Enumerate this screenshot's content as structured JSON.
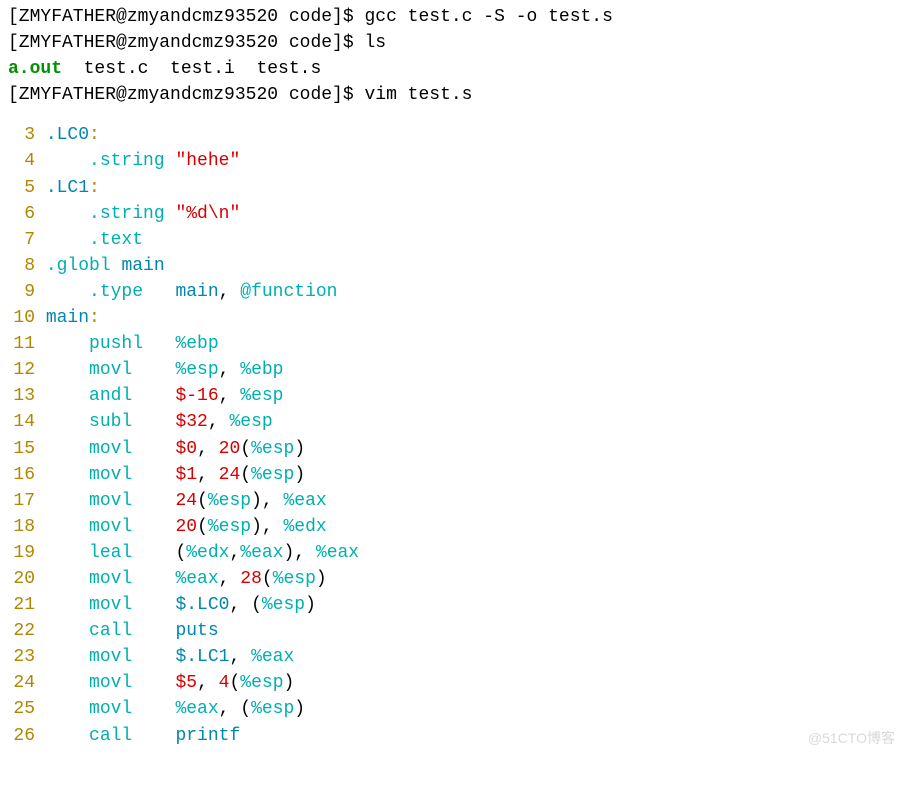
{
  "terminal": {
    "prompt": "[ZMYFATHER@zmyandcmz93520 code]$ ",
    "lines": [
      {
        "type": "cmd",
        "text": "gcc test.c -S -o test.s"
      },
      {
        "type": "cmd",
        "text": "ls"
      },
      {
        "type": "ls"
      },
      {
        "type": "cmd",
        "text": "vim test.s"
      }
    ],
    "ls": {
      "exe": "a.out",
      "rest": "  test.c  test.i  test.s"
    }
  },
  "code": [
    {
      "n": "3",
      "tokens": [
        {
          "c": "plain",
          "t": " "
        },
        {
          "c": "blue",
          "t": ".LC0"
        },
        {
          "c": "yellow",
          "t": ":"
        }
      ]
    },
    {
      "n": "4",
      "tokens": [
        {
          "c": "plain",
          "t": "     "
        },
        {
          "c": "cyan",
          "t": ".string"
        },
        {
          "c": "plain",
          "t": " "
        },
        {
          "c": "red",
          "t": "\"hehe\""
        }
      ]
    },
    {
      "n": "5",
      "tokens": [
        {
          "c": "plain",
          "t": " "
        },
        {
          "c": "blue",
          "t": ".LC1"
        },
        {
          "c": "yellow",
          "t": ":"
        }
      ]
    },
    {
      "n": "6",
      "tokens": [
        {
          "c": "plain",
          "t": "     "
        },
        {
          "c": "cyan",
          "t": ".string"
        },
        {
          "c": "plain",
          "t": " "
        },
        {
          "c": "red",
          "t": "\"%d\\n\""
        }
      ]
    },
    {
      "n": "7",
      "tokens": [
        {
          "c": "plain",
          "t": "     "
        },
        {
          "c": "cyan",
          "t": ".text"
        }
      ]
    },
    {
      "n": "8",
      "tokens": [
        {
          "c": "plain",
          "t": " "
        },
        {
          "c": "cyan",
          "t": ".globl"
        },
        {
          "c": "plain",
          "t": " "
        },
        {
          "c": "blue",
          "t": "main"
        }
      ]
    },
    {
      "n": "9",
      "tokens": [
        {
          "c": "plain",
          "t": "     "
        },
        {
          "c": "cyan",
          "t": ".type"
        },
        {
          "c": "plain",
          "t": "   "
        },
        {
          "c": "blue",
          "t": "main"
        },
        {
          "c": "plain",
          "t": ", "
        },
        {
          "c": "cyan",
          "t": "@function"
        }
      ]
    },
    {
      "n": "10",
      "tokens": [
        {
          "c": "plain",
          "t": " "
        },
        {
          "c": "blue",
          "t": "main"
        },
        {
          "c": "yellow",
          "t": ":"
        }
      ]
    },
    {
      "n": "11",
      "tokens": [
        {
          "c": "plain",
          "t": "     "
        },
        {
          "c": "cyan",
          "t": "pushl"
        },
        {
          "c": "plain",
          "t": "   "
        },
        {
          "c": "cyan",
          "t": "%ebp"
        }
      ]
    },
    {
      "n": "12",
      "tokens": [
        {
          "c": "plain",
          "t": "     "
        },
        {
          "c": "cyan",
          "t": "movl"
        },
        {
          "c": "plain",
          "t": "    "
        },
        {
          "c": "cyan",
          "t": "%esp"
        },
        {
          "c": "plain",
          "t": ", "
        },
        {
          "c": "cyan",
          "t": "%ebp"
        }
      ]
    },
    {
      "n": "13",
      "tokens": [
        {
          "c": "plain",
          "t": "     "
        },
        {
          "c": "cyan",
          "t": "andl"
        },
        {
          "c": "plain",
          "t": "    "
        },
        {
          "c": "red",
          "t": "$-16"
        },
        {
          "c": "plain",
          "t": ", "
        },
        {
          "c": "cyan",
          "t": "%esp"
        }
      ]
    },
    {
      "n": "14",
      "tokens": [
        {
          "c": "plain",
          "t": "     "
        },
        {
          "c": "cyan",
          "t": "subl"
        },
        {
          "c": "plain",
          "t": "    "
        },
        {
          "c": "red",
          "t": "$32"
        },
        {
          "c": "plain",
          "t": ", "
        },
        {
          "c": "cyan",
          "t": "%esp"
        }
      ]
    },
    {
      "n": "15",
      "tokens": [
        {
          "c": "plain",
          "t": "     "
        },
        {
          "c": "cyan",
          "t": "movl"
        },
        {
          "c": "plain",
          "t": "    "
        },
        {
          "c": "red",
          "t": "$0"
        },
        {
          "c": "plain",
          "t": ", "
        },
        {
          "c": "red",
          "t": "20"
        },
        {
          "c": "plain",
          "t": "("
        },
        {
          "c": "cyan",
          "t": "%esp"
        },
        {
          "c": "plain",
          "t": ")"
        }
      ]
    },
    {
      "n": "16",
      "tokens": [
        {
          "c": "plain",
          "t": "     "
        },
        {
          "c": "cyan",
          "t": "movl"
        },
        {
          "c": "plain",
          "t": "    "
        },
        {
          "c": "red",
          "t": "$1"
        },
        {
          "c": "plain",
          "t": ", "
        },
        {
          "c": "red",
          "t": "24"
        },
        {
          "c": "plain",
          "t": "("
        },
        {
          "c": "cyan",
          "t": "%esp"
        },
        {
          "c": "plain",
          "t": ")"
        }
      ]
    },
    {
      "n": "17",
      "tokens": [
        {
          "c": "plain",
          "t": "     "
        },
        {
          "c": "cyan",
          "t": "movl"
        },
        {
          "c": "plain",
          "t": "    "
        },
        {
          "c": "red",
          "t": "24"
        },
        {
          "c": "plain",
          "t": "("
        },
        {
          "c": "cyan",
          "t": "%esp"
        },
        {
          "c": "plain",
          "t": "), "
        },
        {
          "c": "cyan",
          "t": "%eax"
        }
      ]
    },
    {
      "n": "18",
      "tokens": [
        {
          "c": "plain",
          "t": "     "
        },
        {
          "c": "cyan",
          "t": "movl"
        },
        {
          "c": "plain",
          "t": "    "
        },
        {
          "c": "red",
          "t": "20"
        },
        {
          "c": "plain",
          "t": "("
        },
        {
          "c": "cyan",
          "t": "%esp"
        },
        {
          "c": "plain",
          "t": "), "
        },
        {
          "c": "cyan",
          "t": "%edx"
        }
      ]
    },
    {
      "n": "19",
      "tokens": [
        {
          "c": "plain",
          "t": "     "
        },
        {
          "c": "cyan",
          "t": "leal"
        },
        {
          "c": "plain",
          "t": "    ("
        },
        {
          "c": "cyan",
          "t": "%edx"
        },
        {
          "c": "plain",
          "t": ","
        },
        {
          "c": "cyan",
          "t": "%eax"
        },
        {
          "c": "plain",
          "t": "), "
        },
        {
          "c": "cyan",
          "t": "%eax"
        }
      ]
    },
    {
      "n": "20",
      "tokens": [
        {
          "c": "plain",
          "t": "     "
        },
        {
          "c": "cyan",
          "t": "movl"
        },
        {
          "c": "plain",
          "t": "    "
        },
        {
          "c": "cyan",
          "t": "%eax"
        },
        {
          "c": "plain",
          "t": ", "
        },
        {
          "c": "red",
          "t": "28"
        },
        {
          "c": "plain",
          "t": "("
        },
        {
          "c": "cyan",
          "t": "%esp"
        },
        {
          "c": "plain",
          "t": ")"
        }
      ]
    },
    {
      "n": "21",
      "tokens": [
        {
          "c": "plain",
          "t": "     "
        },
        {
          "c": "cyan",
          "t": "movl"
        },
        {
          "c": "plain",
          "t": "    "
        },
        {
          "c": "blue",
          "t": "$.LC0"
        },
        {
          "c": "plain",
          "t": ", ("
        },
        {
          "c": "cyan",
          "t": "%esp"
        },
        {
          "c": "plain",
          "t": ")"
        }
      ]
    },
    {
      "n": "22",
      "tokens": [
        {
          "c": "plain",
          "t": "     "
        },
        {
          "c": "cyan",
          "t": "call"
        },
        {
          "c": "plain",
          "t": "    "
        },
        {
          "c": "blue",
          "t": "puts"
        }
      ]
    },
    {
      "n": "23",
      "tokens": [
        {
          "c": "plain",
          "t": "     "
        },
        {
          "c": "cyan",
          "t": "movl"
        },
        {
          "c": "plain",
          "t": "    "
        },
        {
          "c": "blue",
          "t": "$.LC1"
        },
        {
          "c": "plain",
          "t": ", "
        },
        {
          "c": "cyan",
          "t": "%eax"
        }
      ]
    },
    {
      "n": "24",
      "tokens": [
        {
          "c": "plain",
          "t": "     "
        },
        {
          "c": "cyan",
          "t": "movl"
        },
        {
          "c": "plain",
          "t": "    "
        },
        {
          "c": "red",
          "t": "$5"
        },
        {
          "c": "plain",
          "t": ", "
        },
        {
          "c": "red",
          "t": "4"
        },
        {
          "c": "plain",
          "t": "("
        },
        {
          "c": "cyan",
          "t": "%esp"
        },
        {
          "c": "plain",
          "t": ")"
        }
      ]
    },
    {
      "n": "25",
      "tokens": [
        {
          "c": "plain",
          "t": "     "
        },
        {
          "c": "cyan",
          "t": "movl"
        },
        {
          "c": "plain",
          "t": "    "
        },
        {
          "c": "cyan",
          "t": "%eax"
        },
        {
          "c": "plain",
          "t": ", ("
        },
        {
          "c": "cyan",
          "t": "%esp"
        },
        {
          "c": "plain",
          "t": ")"
        }
      ]
    },
    {
      "n": "26",
      "tokens": [
        {
          "c": "plain",
          "t": "     "
        },
        {
          "c": "cyan",
          "t": "call"
        },
        {
          "c": "plain",
          "t": "    "
        },
        {
          "c": "blue",
          "t": "printf"
        }
      ]
    }
  ],
  "watermark": "@51CTO博客"
}
